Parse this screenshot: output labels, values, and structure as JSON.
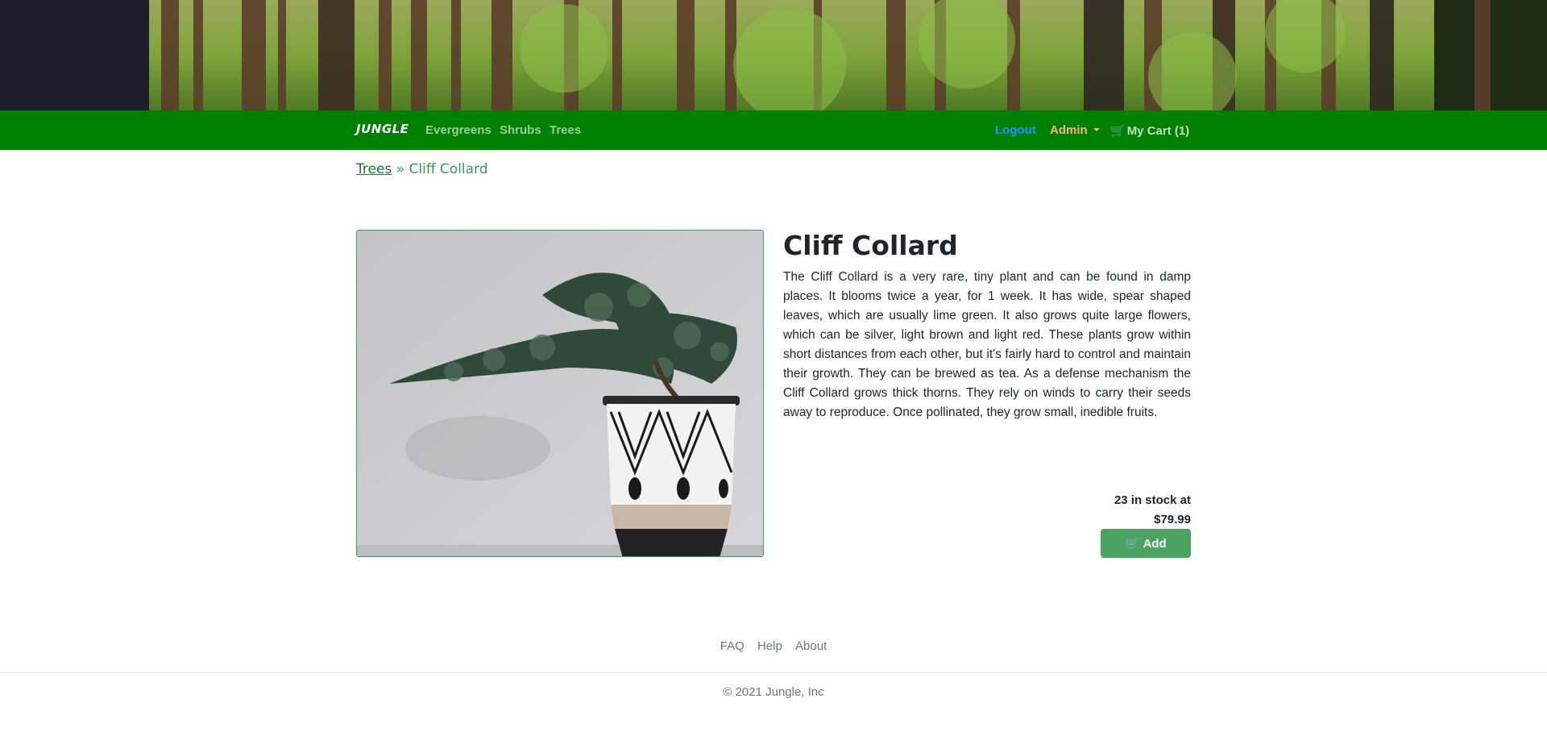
{
  "navbar": {
    "brand": "JUNGLE",
    "links": [
      "Evergreens",
      "Shrubs",
      "Trees"
    ],
    "logout": "Logout",
    "admin": "Admin",
    "cart": "My Cart (1)"
  },
  "breadcrumb": {
    "parent": "Trees",
    "separator": "»",
    "current": "Cliff Collard"
  },
  "product": {
    "name": "Cliff Collard",
    "description": "The Cliff Collard is a very rare, tiny plant and can be found in damp places. It blooms twice a year, for 1 week. It has wide, spear shaped leaves, which are usually lime green. It also grows quite large flowers, which can be silver, light brown and light red. These plants grow within short distances from each other, but it's fairly hard to control and maintain their growth. They can be brewed as tea. As a defense mechanism the Cliff Collard grows thick thorns. They rely on winds to carry their seeds away to reproduce. Once pollinated, they grow small, inedible fruits.",
    "stock_text": "23 in stock at",
    "price": "$79.99",
    "add_label": "Add",
    "image_icon": "potted-bonsai-photo"
  },
  "footer": {
    "links": [
      "FAQ",
      "Help",
      "About"
    ],
    "copyright": "© 2021 Jungle, Inc"
  },
  "colors": {
    "navbar": "#008000",
    "accent": "#4aa360",
    "logout": "#2f8fff",
    "admin": "#f2b38a"
  }
}
